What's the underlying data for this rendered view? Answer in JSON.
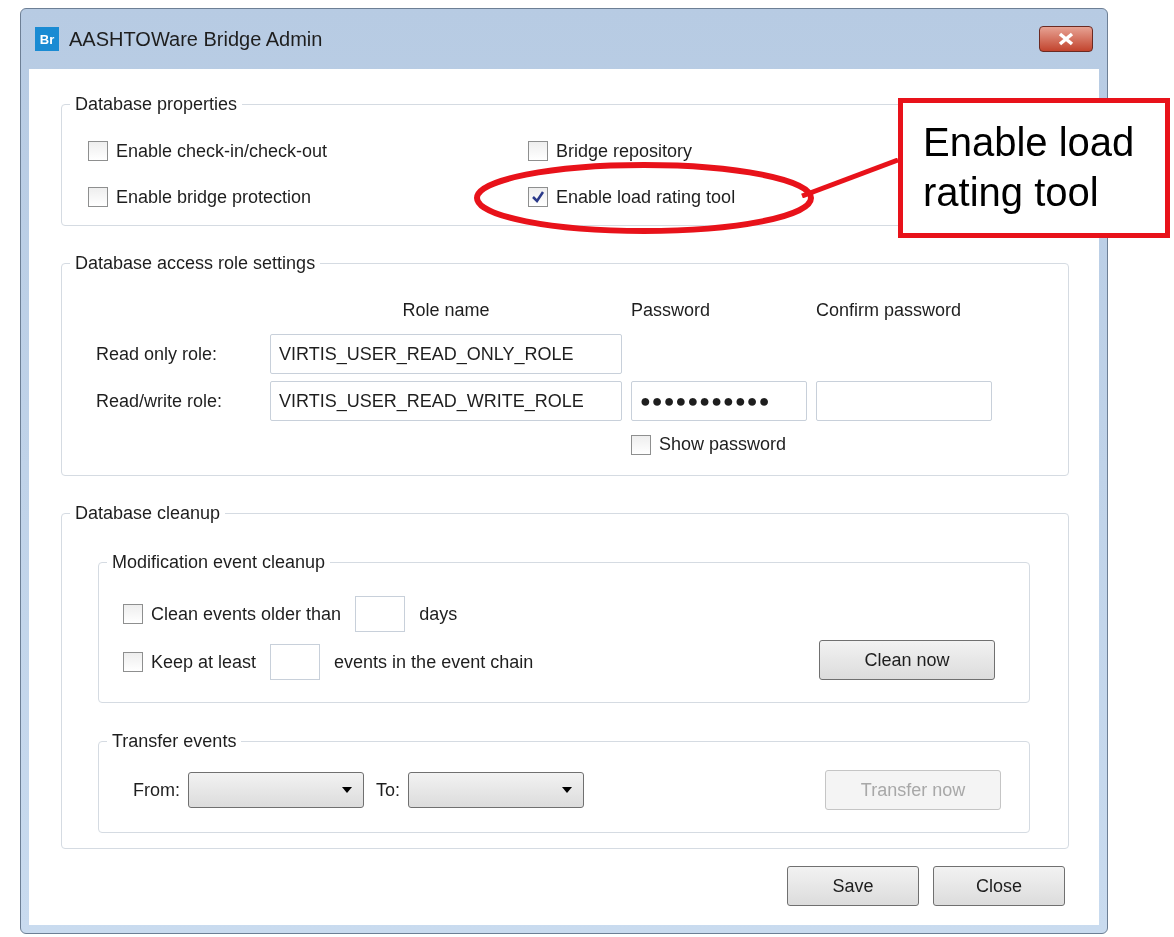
{
  "window": {
    "title": "AASHTOWare Bridge Admin",
    "icon_text": "Br"
  },
  "database_properties": {
    "title": "Database properties",
    "options": [
      {
        "label": "Enable check-in/check-out",
        "checked": false
      },
      {
        "label": "Bridge repository",
        "checked": false
      },
      {
        "label": "Enable bridge protection",
        "checked": false
      },
      {
        "label": "Enable load rating tool",
        "checked": true
      }
    ]
  },
  "access_roles": {
    "title": "Database access role settings",
    "columns": [
      "Role name",
      "Password",
      "Confirm password"
    ],
    "rows": [
      {
        "label": "Read only role:",
        "role": "VIRTIS_USER_READ_ONLY_ROLE"
      },
      {
        "label": "Read/write role:",
        "role": "VIRTIS_USER_READ_WRITE_ROLE",
        "password": "●●●●●●●●●●●",
        "confirm": ""
      }
    ],
    "show_password": {
      "label": "Show password",
      "checked": false
    }
  },
  "cleanup": {
    "title": "Database cleanup",
    "modification": {
      "title": "Modification event cleanup",
      "rows": [
        {
          "before": "Clean events older than",
          "after": "days",
          "checked": false
        },
        {
          "before": "Keep at least",
          "after": "events in the event chain",
          "checked": false
        }
      ],
      "button": {
        "label": "Clean now",
        "disabled": false
      }
    },
    "transfer": {
      "title": "Transfer events",
      "from_label": "From:",
      "to_label": "To:",
      "button": {
        "label": "Transfer now",
        "disabled": true
      }
    }
  },
  "buttons": [
    {
      "label": "Save"
    },
    {
      "label": "Close"
    }
  ],
  "annotation": {
    "callout": "Enable load rating tool"
  }
}
